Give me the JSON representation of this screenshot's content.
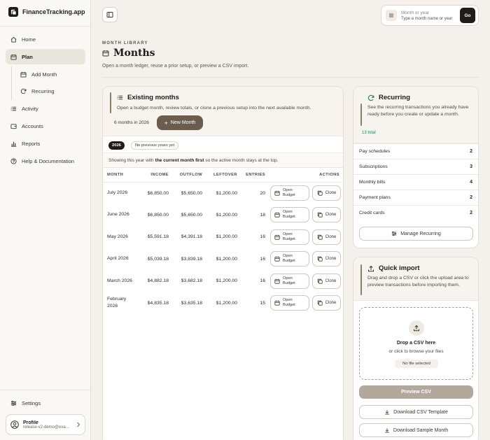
{
  "app": {
    "name": "FinanceTracking.app"
  },
  "sidebar": {
    "items": [
      {
        "label": "Home",
        "icon": "home-icon"
      },
      {
        "label": "Plan",
        "icon": "calendar-icon",
        "active": true
      },
      {
        "label": "Add Month",
        "icon": "calendar-plus-icon"
      },
      {
        "label": "Recurring",
        "icon": "refresh-icon"
      },
      {
        "label": "Activity",
        "icon": "list-icon"
      },
      {
        "label": "Accounts",
        "icon": "wallet-icon"
      },
      {
        "label": "Reports",
        "icon": "bar-chart-icon"
      },
      {
        "label": "Help & Documentation",
        "icon": "help-icon"
      }
    ],
    "settings_label": "Settings",
    "profile": {
      "name": "Profile",
      "email": "release-v2-demo@exa..."
    }
  },
  "topbar": {
    "search_label": "Month or year",
    "search_hint": "Type a month name or year",
    "go_label": "Go"
  },
  "page": {
    "eyebrow": "MONTH LIBRARY",
    "title": "Months",
    "subtitle": "Open a month ledger, reuse a prior setup, or preview a CSV import."
  },
  "existing": {
    "title": "Existing months",
    "description": "Open a budget month, review totals, or clone a previous setup into the next available month.",
    "count_label": "6 months in 2026",
    "new_month_label": "New Month",
    "year_active": "2026",
    "year_note": "No previous years yet",
    "showing_pre": "Showing this year with",
    "showing_bold": "the current month first",
    "showing_post": "so the active month stays at the top.",
    "columns": [
      "MONTH",
      "INCOME",
      "OUTFLOW",
      "LEFTOVER",
      "ENTRIES",
      "ACTIONS"
    ],
    "open_label_1": "Open",
    "open_label_2": "Budget",
    "clone_label": "Clone",
    "rows": [
      {
        "month": "July 2026",
        "income": "$6,850.00",
        "outflow": "$5,650.00",
        "leftover": "$1,200.00",
        "entries": "20"
      },
      {
        "month": "June 2026",
        "income": "$6,850.00",
        "outflow": "$5,650.00",
        "leftover": "$1,200.00",
        "entries": "18"
      },
      {
        "month": "May 2026",
        "income": "$5,591.18",
        "outflow": "$4,391.18",
        "leftover": "$1,200.00",
        "entries": "16"
      },
      {
        "month": "April 2026",
        "income": "$5,039.18",
        "outflow": "$3,839.18",
        "leftover": "$1,200.00",
        "entries": "16"
      },
      {
        "month": "March 2026",
        "income": "$4,882.18",
        "outflow": "$3,682.18",
        "leftover": "$1,200.00",
        "entries": "16"
      },
      {
        "month": "February 2026",
        "income": "$4,835.18",
        "outflow": "$3,635.18",
        "leftover": "$1,200.00",
        "entries": "15"
      }
    ]
  },
  "recurring": {
    "title": "Recurring",
    "description": "See the recurring transactions you already have ready before you create or update a month.",
    "total_badge": "13 total",
    "rows": [
      {
        "label": "Pay schedules",
        "count": "2"
      },
      {
        "label": "Subscriptions",
        "count": "3"
      },
      {
        "label": "Monthly bills",
        "count": "4"
      },
      {
        "label": "Payment plans",
        "count": "2"
      },
      {
        "label": "Credit cards",
        "count": "2"
      }
    ],
    "manage_label": "Manage Recurring"
  },
  "import": {
    "title": "Quick import",
    "description": "Drag and drop a CSV or click the upload area to preview transactions before importing them.",
    "drop_title": "Drop a CSV here",
    "drop_sub": "or click to browse your files",
    "no_file": "No file selected",
    "preview_label": "Preview CSV",
    "template_label": "Download CSV Template",
    "sample_label": "Download Sample Month"
  }
}
